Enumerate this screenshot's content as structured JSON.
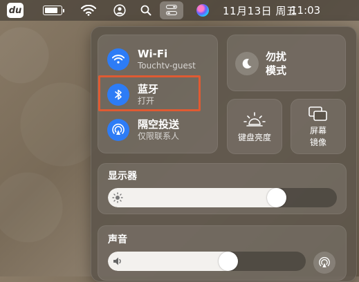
{
  "menubar": {
    "app_logo_text": "du",
    "date": "11月13日 周五",
    "time": "11:03",
    "battery_level": 0.8,
    "icons": [
      "battery-icon",
      "wifi-icon",
      "user-icon",
      "search-icon",
      "control-center-icon",
      "siri-icon"
    ]
  },
  "control_center": {
    "wifi": {
      "title": "Wi-Fi",
      "subtitle": "Touchtv-guest",
      "icon": "wifi-icon"
    },
    "bluetooth": {
      "title": "蓝牙",
      "subtitle": "打开",
      "icon": "bluetooth-icon",
      "highlight_color": "#e05a32"
    },
    "airdrop": {
      "title": "隔空投送",
      "subtitle": "仅限联系人",
      "icon": "airdrop-icon"
    },
    "do_not_disturb": {
      "label": "勿扰\n模式",
      "line1": "勿扰",
      "line2": "模式",
      "icon": "moon-icon"
    },
    "keyboard_brightness": {
      "label": "键盘亮度",
      "icon": "keyboard-brightness-icon"
    },
    "screen_mirroring": {
      "line1": "屏幕",
      "line2": "镜像",
      "icon": "screen-mirroring-icon"
    },
    "display": {
      "title": "显示器",
      "brightness": 0.76,
      "icon": "sun-icon"
    },
    "sound": {
      "title": "声音",
      "volume": 0.62,
      "icon": "speaker-icon",
      "airplay_icon": "airplay-audio-icon"
    }
  },
  "colors": {
    "accent_blue": "#2d7cf6",
    "highlight": "#e05a32"
  }
}
